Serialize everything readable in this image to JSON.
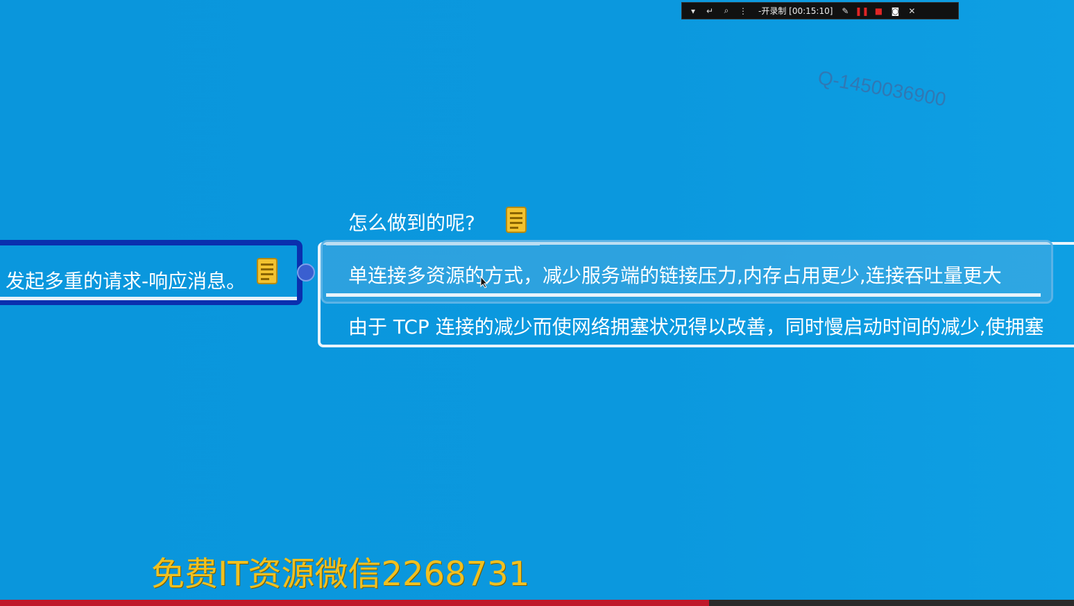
{
  "recorder": {
    "status_text": "-开录制 [00:15:10]",
    "icons": [
      "dropdown-icon",
      "return-icon",
      "zoom-icon",
      "dots-icon",
      "pen-icon",
      "pause-icon",
      "stop-icon",
      "camera-icon",
      "close-icon"
    ],
    "colors": {
      "background": "#111111",
      "stop": "#e02525"
    }
  },
  "watermark": {
    "text": "Q-1450036900"
  },
  "mindmap": {
    "left_topic": {
      "text": "发起多重的请求-响应消息。"
    },
    "question": {
      "text": "怎么做到的呢?"
    },
    "answers": [
      {
        "text": "单连接多资源的方式，减少服务端的链接压力,内存占用更少,连接吞吐量更大"
      },
      {
        "text": "由于 TCP 连接的减少而使网络拥塞状况得以改善，同时慢启动时间的减少,使拥塞"
      }
    ],
    "note_icon_color": "#f2c230"
  },
  "caption": {
    "text": "免费IT资源微信2268731",
    "color": "#f0c020"
  },
  "video_progress": {
    "fraction": 0.66,
    "color": "#c0182a"
  },
  "colors": {
    "background": "#0a97dd",
    "selected_border": "#0a2fae"
  }
}
